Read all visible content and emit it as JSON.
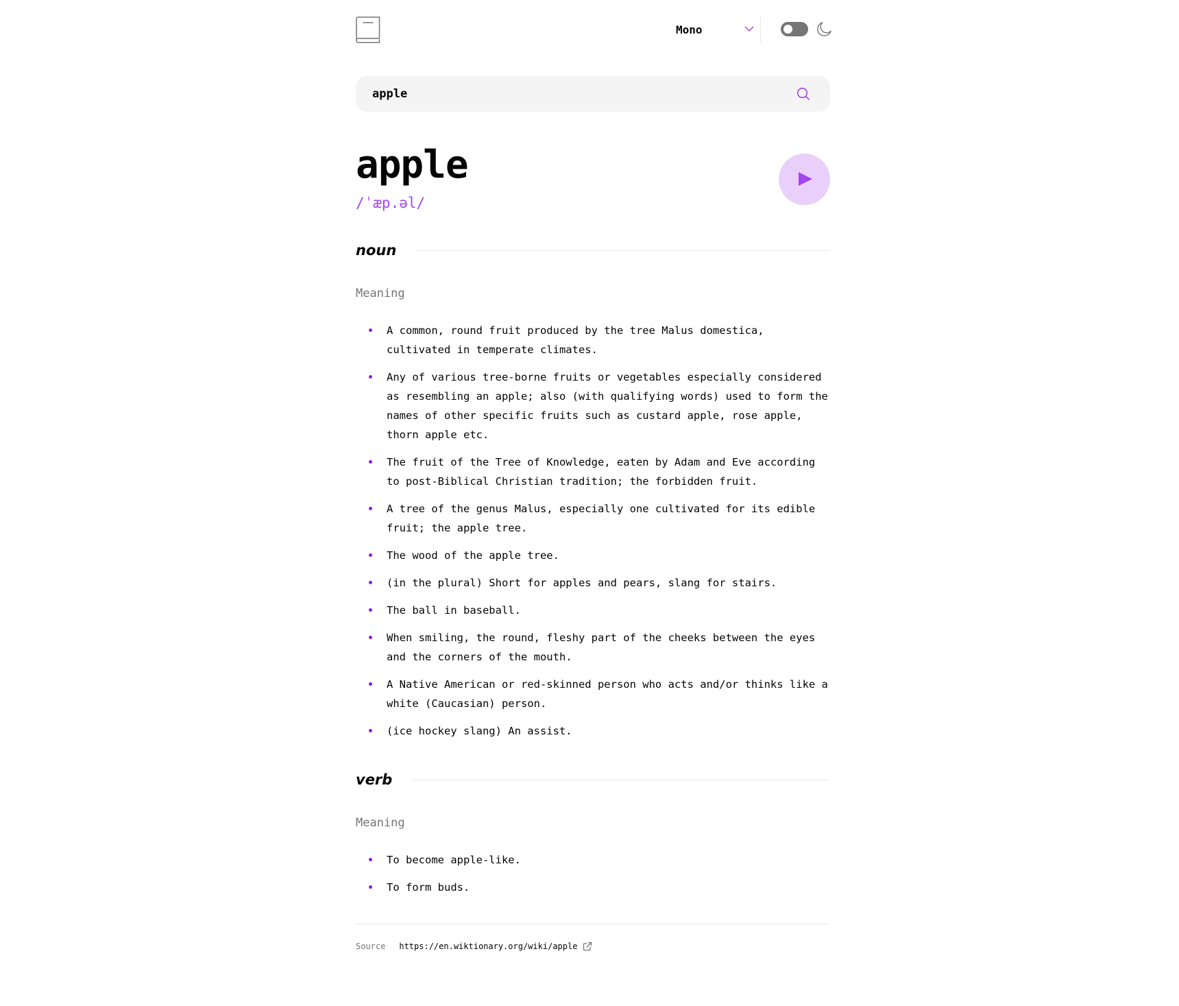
{
  "header": {
    "font_select": {
      "selected": "Mono"
    },
    "theme_toggle": {
      "state": "off"
    },
    "icons": {
      "logo": "book-icon",
      "chevron": "chevron-down-icon",
      "moon": "moon-icon"
    }
  },
  "search": {
    "value": "apple",
    "icon": "search-icon"
  },
  "entry": {
    "word": "apple",
    "phonetic": "/ˈæp.əl/",
    "play_icon": "play-icon",
    "meanings": [
      {
        "part_of_speech": "noun",
        "meaning_label": "Meaning",
        "definitions": [
          "A common, round fruit produced by the tree Malus domestica, cultivated in temperate climates.",
          "Any of various tree-borne fruits or vegetables especially considered as resembling an apple; also (with qualifying words) used to form the names of other specific fruits such as custard apple, rose apple, thorn apple etc.",
          "The fruit of the Tree of Knowledge, eaten by Adam and Eve according to post-Biblical Christian tradition; the forbidden fruit.",
          "A tree of the genus Malus, especially one cultivated for its edible fruit; the apple tree.",
          "The wood of the apple tree.",
          "(in the plural) Short for apples and pears, slang for stairs.",
          "The ball in baseball.",
          "When smiling, the round, fleshy part of the cheeks between the eyes and the corners of the mouth.",
          "A Native American or red-skinned person who acts and/or thinks like a white (Caucasian) person.",
          "(ice hockey slang) An assist."
        ]
      },
      {
        "part_of_speech": "verb",
        "meaning_label": "Meaning",
        "definitions": [
          "To become apple-like.",
          "To form buds."
        ]
      }
    ]
  },
  "source": {
    "label": "Source",
    "url": "https://en.wiktionary.org/wiki/apple",
    "icon": "external-link-icon"
  },
  "colors": {
    "accent": "#a445ed",
    "bullet": "#8f19e8",
    "text": "#050505",
    "muted": "#757575",
    "search_bg": "#f4f4f4",
    "divider": "#e9e9e9"
  }
}
